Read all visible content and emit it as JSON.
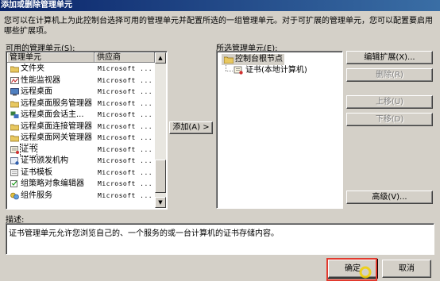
{
  "window": {
    "title": "添加或删除管理单元"
  },
  "intro": "您可以在计算机上为此控制台选择可用的管理单元并配置所选的一组管理单元。对于可扩展的管理单元，您可以配置要启用哪些扩展项。",
  "available": {
    "label": "可用的管理单元(S):",
    "columns": {
      "name": "管理单元",
      "vendor": "供应商"
    },
    "items": [
      {
        "name": "文件夹",
        "vendor": "Microsoft ...",
        "icon": "folder-icon"
      },
      {
        "name": "性能监视器",
        "vendor": "Microsoft ...",
        "icon": "performance-monitor-icon"
      },
      {
        "name": "远程桌面",
        "vendor": "Microsoft ...",
        "icon": "remote-desktop-icon"
      },
      {
        "name": "远程桌面服务管理器",
        "vendor": "Microsoft ...",
        "icon": "folder-icon"
      },
      {
        "name": "远程桌面会话主...",
        "vendor": "Microsoft ...",
        "icon": "session-host-icon"
      },
      {
        "name": "远程桌面连接管理器",
        "vendor": "Microsoft ...",
        "icon": "folder-icon"
      },
      {
        "name": "远程桌面网关管理器",
        "vendor": "Microsoft ...",
        "icon": "folder-icon"
      },
      {
        "name": "证书",
        "vendor": "Microsoft ...",
        "icon": "certificate-icon",
        "selected": true
      },
      {
        "name": "证书颁发机构",
        "vendor": "Microsoft ...",
        "icon": "certificate-authority-icon"
      },
      {
        "name": "证书模板",
        "vendor": "Microsoft ...",
        "icon": "certificate-template-icon"
      },
      {
        "name": "组策略对象编辑器",
        "vendor": "Microsoft ...",
        "icon": "group-policy-icon"
      },
      {
        "name": "组件服务",
        "vendor": "Microsoft ...",
        "icon": "component-services-icon"
      }
    ]
  },
  "add_button": "添加(A) >",
  "selected": {
    "label": "所选管理单元(E):",
    "root": "控制台根节点",
    "child": "证书(本地计算机)"
  },
  "side_buttons": {
    "edit_extensions": "编辑扩展(X)...",
    "remove": "删除(R)",
    "move_up": "上移(U)",
    "move_down": "下移(D)",
    "advanced": "高级(V)..."
  },
  "description": {
    "label": "描述:",
    "text": "证书管理单元允许您浏览自己的、一个服务的或一台计算机的证书存储内容。"
  },
  "footer": {
    "ok": "确定",
    "cancel": "取消"
  },
  "colors": {
    "title_bar": "#0a246a",
    "dialog_bg": "#d4d0c8",
    "highlight": "#e23a2e"
  }
}
